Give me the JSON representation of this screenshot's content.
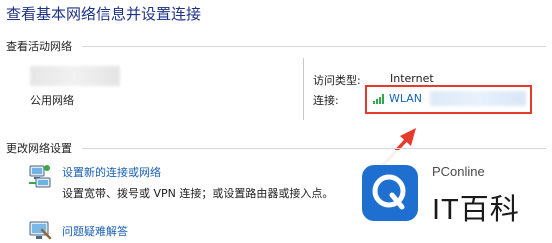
{
  "window": {
    "title": "查看基本网络信息并设置连接"
  },
  "active_networks": {
    "label": "查看活动网络",
    "network_type": "公用网络",
    "access_type_label": "访问类型:",
    "access_type_value": "Internet",
    "connections_label": "连接:",
    "connection_name": "WLAN",
    "signal_icon": "wifi-signal-bars-icon"
  },
  "change_settings": {
    "label": "更改网络设置",
    "items": [
      {
        "title": "设置新的连接或网络",
        "description": "设置宽带、拨号或 VPN 连接；或设置路由器或接入点。",
        "icon": "network-setup-icon"
      },
      {
        "title": "问题疑难解答",
        "description": "",
        "icon": "troubleshoot-icon"
      }
    ]
  },
  "watermark": {
    "small": "PConline",
    "big": "IT百科"
  },
  "colors": {
    "title_blue": "#1e3287",
    "link_blue": "#1565c0",
    "highlight_red": "#e53a2c",
    "signal_green": "#2fa84f",
    "brand_blue": "#1f6fd1"
  }
}
